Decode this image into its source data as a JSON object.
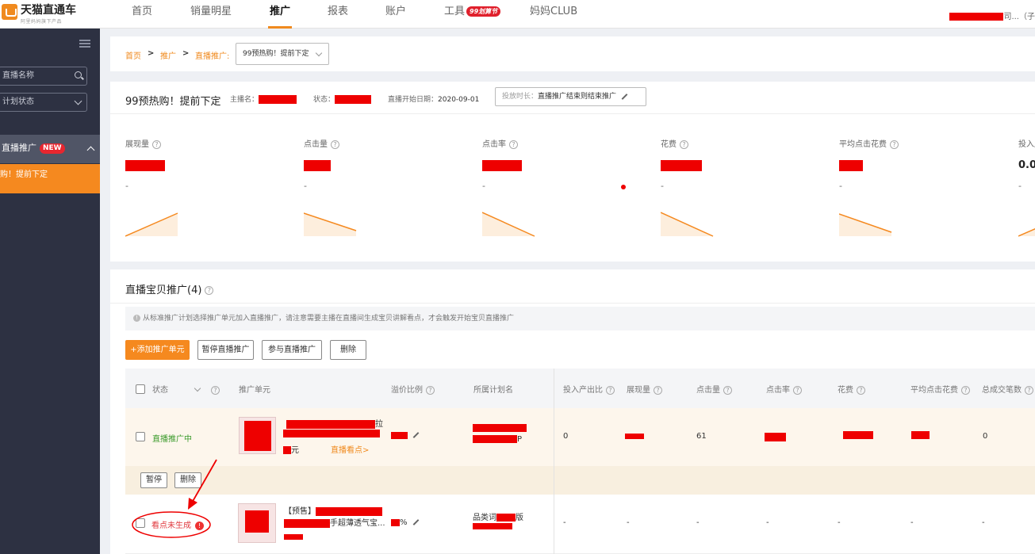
{
  "brand": {
    "title": "天猫直通车",
    "subtitle": "阿里妈妈旗下产品"
  },
  "nav": {
    "items": [
      "首页",
      "销量明星",
      "推广",
      "报表",
      "账户",
      "工具",
      "妈妈CLUB"
    ],
    "active": "推广",
    "tools_badge": "99划算节"
  },
  "user": {
    "suffix": "司...（子"
  },
  "sidebar": {
    "search_placeholder": "直播名称",
    "status_select": "计划状态",
    "group_label": "直播推广",
    "group_badge": "NEW",
    "active_item": "购！提前下定"
  },
  "breadcrumb": {
    "home": "首页",
    "promo": "推广",
    "live": "直播推广:",
    "plan": "99预热购！提前下定"
  },
  "stats": {
    "title": "99预热购！提前下定",
    "anchor_label": "主播名：",
    "status_label": "状态：",
    "start_label": "直播开始日期：",
    "start_value": "2020-09-01",
    "duration_label": "投放时长：",
    "duration_value": "直播推广结束则结束推广",
    "metrics": [
      {
        "label": "展现量",
        "value": "",
        "dash": "-",
        "trend": "up"
      },
      {
        "label": "点击量",
        "value": "",
        "dash": "-",
        "trend": "down"
      },
      {
        "label": "点击率",
        "value": "",
        "dash": "-",
        "trend": "down"
      },
      {
        "label": "花费",
        "value": "",
        "dash": "-",
        "trend": "down"
      },
      {
        "label": "平均点击花费",
        "value": "",
        "dash": "-",
        "trend": "down"
      },
      {
        "label": "投入产出比",
        "value": "0.0",
        "dash": "-",
        "trend": "up"
      }
    ]
  },
  "table": {
    "title": "直播宝贝推广(4)",
    "hint": "从标准推广计划选择推广单元加入直播推广，请注意需要主播在直播间生成宝贝讲解看点，才会触发开始宝贝直播推广",
    "buttons": {
      "add": "+添加推广单元",
      "pause": "暂停直播推广",
      "join": "参与直播推广",
      "delete": "删除"
    },
    "headers": {
      "status": "状态",
      "unit": "推广单元",
      "premium": "溢价比例",
      "plan": "所属计划名",
      "roi": "投入产出比",
      "impressions": "展现量",
      "clicks": "点击量",
      "ctr": "点击率",
      "cost": "花费",
      "cpc": "平均点击花费",
      "orders": "总成交笔数"
    },
    "rows": [
      {
        "status": "直播推广中",
        "status_color": "#3a9a2a",
        "title_end": "拉",
        "price_suffix": "元",
        "live_link": "直播看点>",
        "plan_suffix": "P",
        "roi": "0",
        "clicks": "61",
        "orders": "0",
        "actions": [
          "暂停",
          "删除"
        ]
      },
      {
        "status": "看点未生成",
        "status_color": "#e0383e",
        "title_prefix": "【预售】",
        "title_mid": "手超薄透气宝...",
        "premium_suffix": "%",
        "plan_prefix": "品类词",
        "plan_end": "版",
        "roi": "-",
        "impressions": "-",
        "clicks": "-",
        "ctr": "-",
        "cost": "-",
        "cpc": "-",
        "orders": "-"
      }
    ]
  },
  "colors": {
    "accent": "#f5891f",
    "redaction": "#ee0000",
    "sidebar": "#2d3142"
  }
}
